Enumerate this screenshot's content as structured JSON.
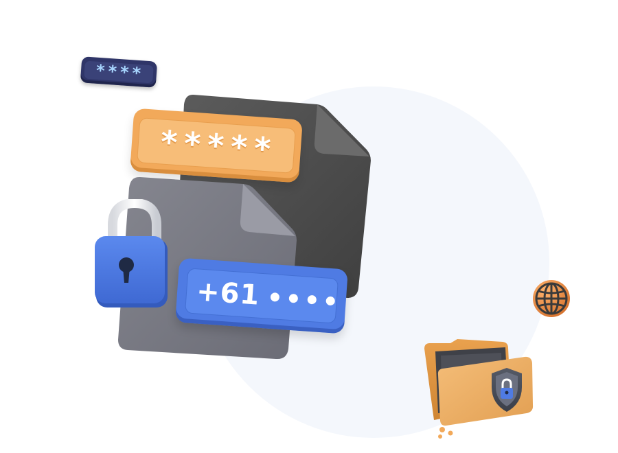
{
  "illustration": {
    "password_chip_small": {
      "mask": "****"
    },
    "password_chip_large": {
      "mask": "*****"
    },
    "phone_chip": {
      "prefix": "+61",
      "dot_count": 4
    },
    "icons": [
      "padlock-icon",
      "globe-icon",
      "folder-icon",
      "shield-lock-icon",
      "document-icon"
    ]
  },
  "colors": {
    "background": "#ffffff",
    "circle": "#f4f7fc",
    "dark_doc": "#505050",
    "gray_doc": "#7a7b86",
    "orange": "#f2a95a",
    "blue": "#4f7be3",
    "navy": "#2f3568",
    "mask_text": "#a8d6ff"
  }
}
